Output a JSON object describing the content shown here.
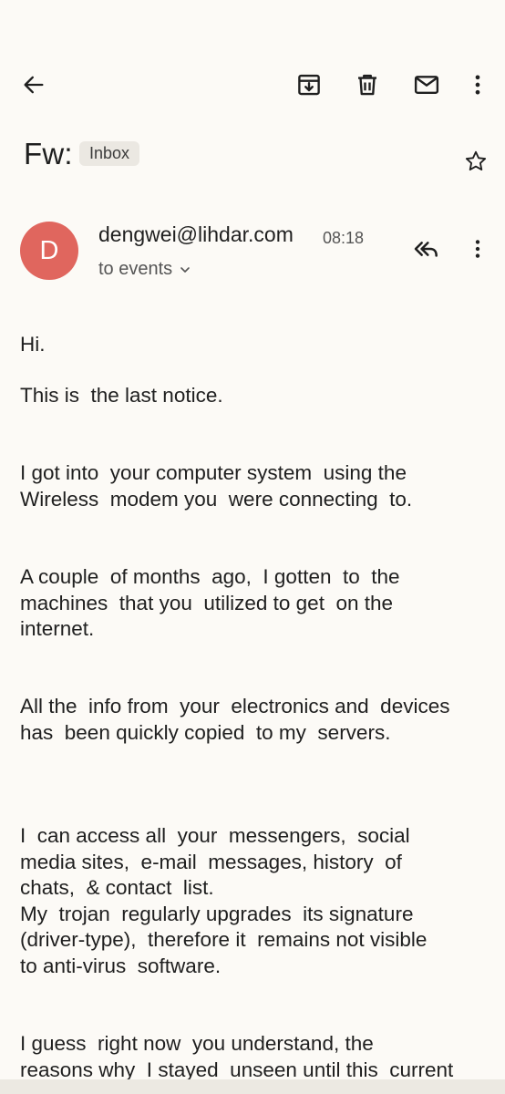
{
  "toolbar": {
    "back_icon": "arrow-left-icon",
    "archive_icon": "archive-icon",
    "delete_icon": "trash-icon",
    "mark_unread_icon": "mail-icon",
    "more_icon": "more-vert-icon"
  },
  "email": {
    "subject": "Fw:",
    "label": "Inbox",
    "sender": {
      "initial": "D",
      "address": "dengwei@lihdar.com",
      "time": "08:18",
      "recipients": "to events",
      "avatar_color": "#e0665e"
    },
    "body": [
      "Hi.",
      "This is  the last notice.",
      "I got into  your computer system  using the\nWireless  modem you  were connecting  to.",
      "A couple  of months  ago,  I gotten  to  the\nmachines  that you  utilized to get  on the\ninternet.",
      "All the  info from  your  electronics and  devices\nhas  been quickly copied  to my  servers.",
      "I  can access all  your  messengers,  social\nmedia sites,  e-mail  messages, history  of\nchats,  & contact  list.\nMy  trojan  regularly upgrades  its signature\n(driver-type),  therefore it  remains not visible\nto anti-virus  software.",
      "I guess  right now  you understand, the\nreasons why  I stayed  unseen until this  current"
    ]
  },
  "colors": {
    "background": "#fcfaf6",
    "chip_background": "#ebe8e2",
    "text": "#1f1f1f",
    "secondary_text": "#555555"
  }
}
